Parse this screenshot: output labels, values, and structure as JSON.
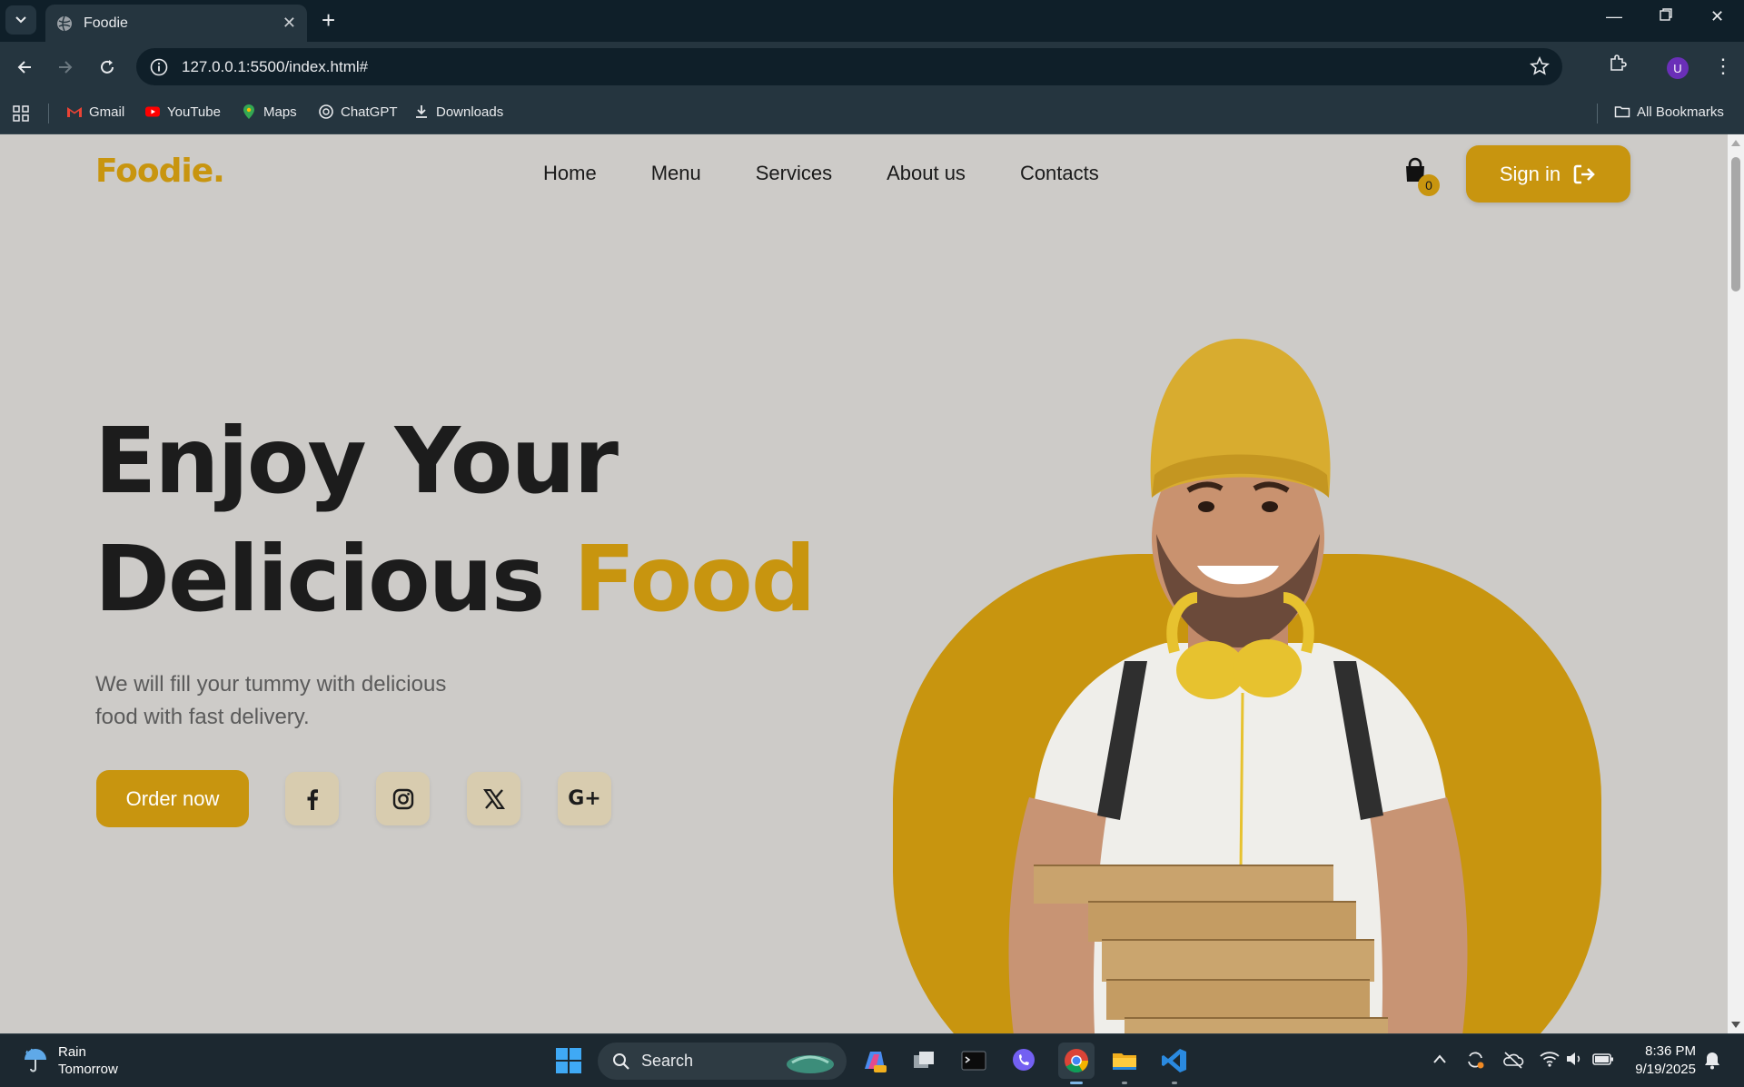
{
  "browser": {
    "tab_title": "Foodie",
    "url": "127.0.0.1:5500/index.html#",
    "bookmarks": [
      "Gmail",
      "YouTube",
      "Maps",
      "ChatGPT",
      "Downloads"
    ],
    "all_bookmarks": "All Bookmarks",
    "profile_initial": "U"
  },
  "site": {
    "logo": "Foodie.",
    "nav": [
      "Home",
      "Menu",
      "Services",
      "About us",
      "Contacts"
    ],
    "cart_count": "0",
    "signin_label": "Sign in",
    "hero": {
      "title_line1": "Enjoy Your",
      "title_line2_a": "Delicious",
      "title_line2_b": "Food",
      "subtitle": "We will fill your tummy with delicious food with fast delivery.",
      "order_label": "Order now"
    },
    "social": [
      "facebook-icon",
      "instagram-icon",
      "x-icon",
      "google-plus-icon"
    ],
    "colors": {
      "accent": "#c8950f",
      "background": "#cdcbc8",
      "text": "#1c1c1c"
    }
  },
  "taskbar": {
    "weather_title": "Rain",
    "weather_sub": "Tomorrow",
    "search_label": "Search",
    "time": "8:36 PM",
    "date": "9/19/2025"
  }
}
